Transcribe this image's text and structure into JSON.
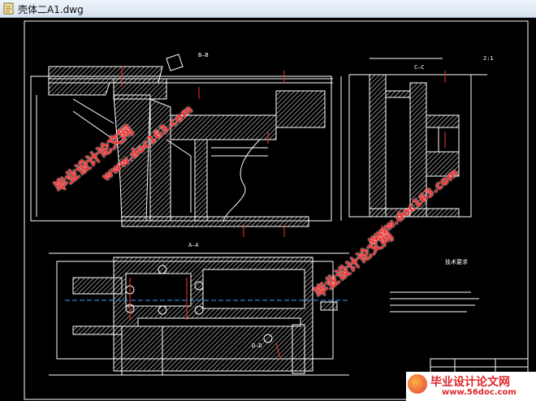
{
  "window": {
    "title": "壳体二A1.dwg",
    "file_icon": "dwg-file-icon"
  },
  "drawing": {
    "section_labels": {
      "bb": "B—B",
      "aa": "A—A",
      "cc": "C—C",
      "dd": "D—D",
      "ratio": "2:1"
    },
    "notes_title": "技术要求"
  },
  "watermarks": {
    "cn": "毕业设计论文网",
    "url": "www.doc163.com",
    "site_title": "毕业设计论文网",
    "site_url": "www.56doc.com"
  },
  "colors": {
    "background": "#000000",
    "lines": "#ffffff",
    "hatch": "#ffffff",
    "centerline": "#ff0000",
    "dimension": "#00ffff"
  }
}
